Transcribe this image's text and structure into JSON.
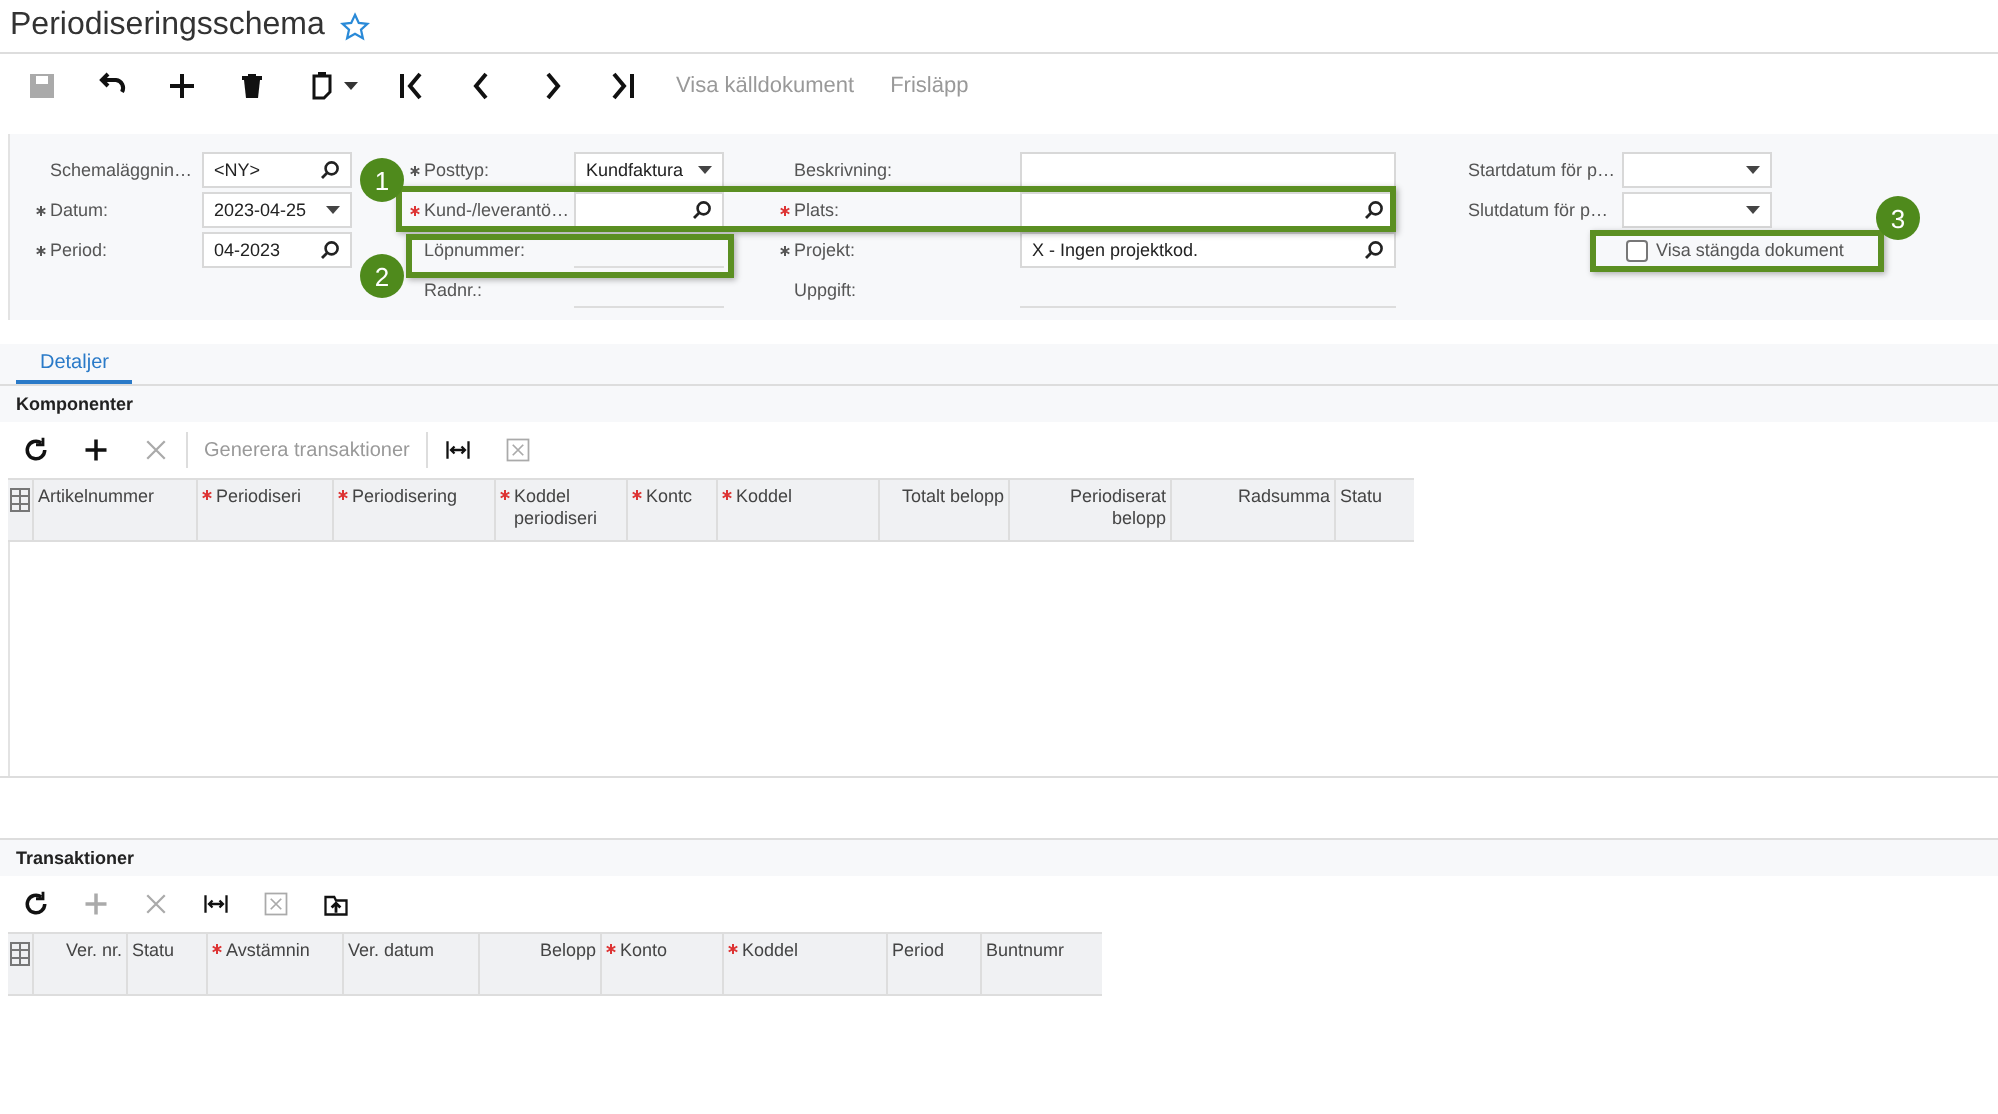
{
  "title": "Periodiseringsschema",
  "favorite": false,
  "toolbar": [
    {
      "disabled": true
    },
    {
      "disabled": false
    },
    {
      "disabled": false
    },
    {
      "disabled": false
    },
    {
      "disabled": false
    },
    {
      "disabled": false
    },
    {
      "disabled": false
    },
    {
      "disabled": false
    },
    {
      "disabled": false
    }
  ],
  "toolbar_actions": [
    {
      "label": "Visa källdokument",
      "disabled": true
    },
    {
      "label": "Frisläpp",
      "disabled": true
    }
  ],
  "form_columns": [
    [
      {
        "label": "Schemaläggnin…",
        "required": false,
        "kind": "lookup",
        "value": "<NY>"
      },
      {
        "label": "Datum:",
        "required": true,
        "kind": "dropdown",
        "value": "2023-04-25"
      },
      {
        "label": "Period:",
        "required": true,
        "kind": "lookup",
        "value": "04-2023"
      }
    ],
    [
      {
        "label": "Posttyp:",
        "required": true,
        "kind": "dropdown",
        "value": "Kundfaktura"
      },
      {
        "label": "Kund-/leverantö…",
        "required": true,
        "kind": "lookup"
      },
      {
        "label": "Löpnummer:",
        "required": false,
        "kind": "readonly"
      },
      {
        "label": "Radnr.:",
        "required": false,
        "kind": "readonly"
      }
    ],
    [
      {
        "label": "Beskrivning:",
        "required": false,
        "kind": "text"
      },
      {
        "label": "Plats:",
        "required": true,
        "kind": "lookup"
      },
      {
        "label": "Projekt:",
        "required": true,
        "kind": "lookup",
        "value": "X - Ingen projektkod."
      },
      {
        "label": "Uppgift:",
        "required": false,
        "kind": "readonly"
      }
    ],
    [
      {
        "label": "Startdatum för p…",
        "required": false,
        "kind": "dropdown"
      },
      {
        "label": "Slutdatum för p…",
        "required": false,
        "kind": "dropdown"
      },
      {
        "label": "Visa stängda dokument",
        "kind": "checkbox",
        "checked": false
      }
    ]
  ],
  "tabs": [
    {
      "label": "Detaljer",
      "selected": true
    }
  ],
  "components": {
    "title": "Komponenter",
    "toolbar": [
      {
        "disabled": false
      },
      {
        "disabled": false
      },
      {
        "disabled": true
      },
      {
        "label": "Generera transaktioner",
        "disabled": true
      },
      {
        "disabled": false
      },
      {
        "disabled": true
      }
    ],
    "columns": [
      {
        "label": "Artikelnummer",
        "required": false
      },
      {
        "label": "Periodiseri",
        "required": true
      },
      {
        "label": "Periodisering",
        "required": true
      },
      {
        "label": "Koddel periodiseri",
        "required": true
      },
      {
        "label": "Kontc",
        "required": true
      },
      {
        "label": "Koddel",
        "required": true
      },
      {
        "label": "Totalt belopp",
        "required": false
      },
      {
        "label": "Periodiserat belopp",
        "required": false
      },
      {
        "label": "Radsumma",
        "required": false
      },
      {
        "label": "Statu",
        "required": false
      }
    ]
  },
  "transactions": {
    "title": "Transaktioner",
    "toolbar": [
      {
        "disabled": false
      },
      {
        "disabled": true
      },
      {
        "disabled": true
      },
      {
        "disabled": false
      },
      {
        "disabled": true
      },
      {
        "disabled": false
      }
    ],
    "columns": [
      {
        "label": "Ver. nr.",
        "required": false
      },
      {
        "label": "Statu",
        "required": false
      },
      {
        "label": "Avstämnin",
        "required": true
      },
      {
        "label": "Ver. datum",
        "required": false
      },
      {
        "label": "Belopp",
        "required": false
      },
      {
        "label": "Konto",
        "required": true
      },
      {
        "label": "Koddel",
        "required": true
      },
      {
        "label": "Period",
        "required": false
      },
      {
        "label": "Buntnumr",
        "required": false
      }
    ]
  },
  "callouts": [
    {
      "number": "1"
    },
    {
      "number": "2"
    },
    {
      "number": "3"
    }
  ]
}
